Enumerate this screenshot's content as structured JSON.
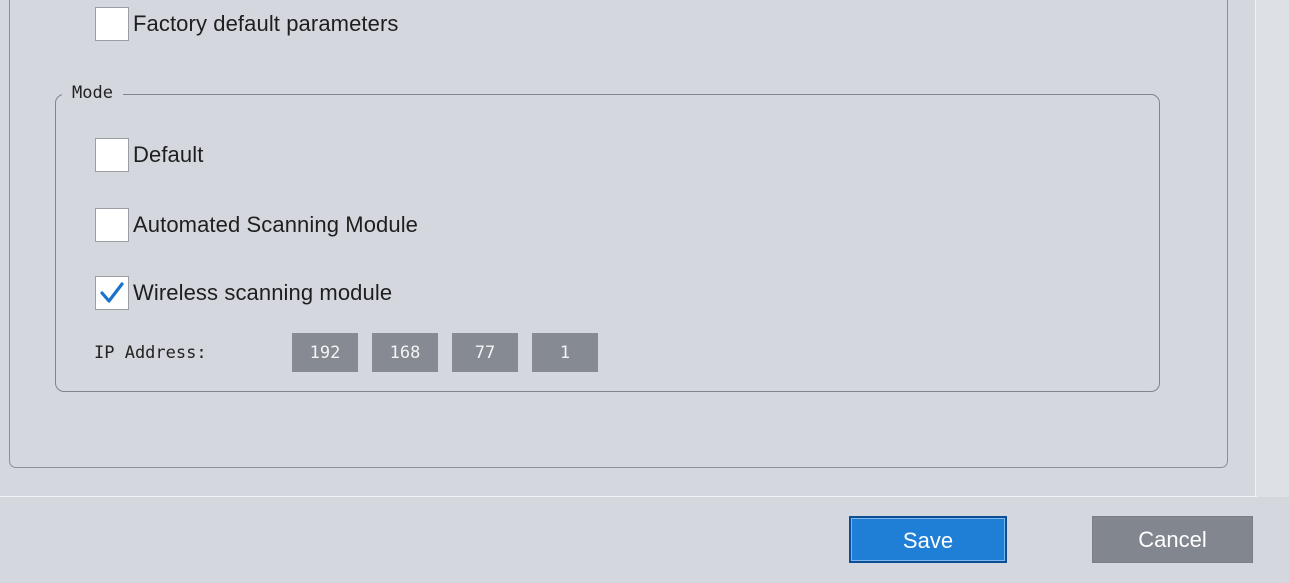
{
  "options": {
    "factory_default_label": "Factory default parameters",
    "factory_default_checked": false
  },
  "mode": {
    "legend": "Mode",
    "default_label": "Default",
    "default_checked": false,
    "automated_label": "Automated Scanning Module",
    "automated_checked": false,
    "wireless_label": "Wireless scanning module",
    "wireless_checked": true,
    "ip": {
      "label": "IP Address:",
      "octet1": "192",
      "octet2": "168",
      "octet3": "77",
      "octet4": "1"
    }
  },
  "footer": {
    "save_label": "Save",
    "cancel_label": "Cancel"
  },
  "colors": {
    "background": "#d4d7dd",
    "accent": "#1f7ed6",
    "checkmark": "#1a73c9",
    "field_bg": "#868a92"
  },
  "icons": {
    "check": "checkmark-icon"
  }
}
